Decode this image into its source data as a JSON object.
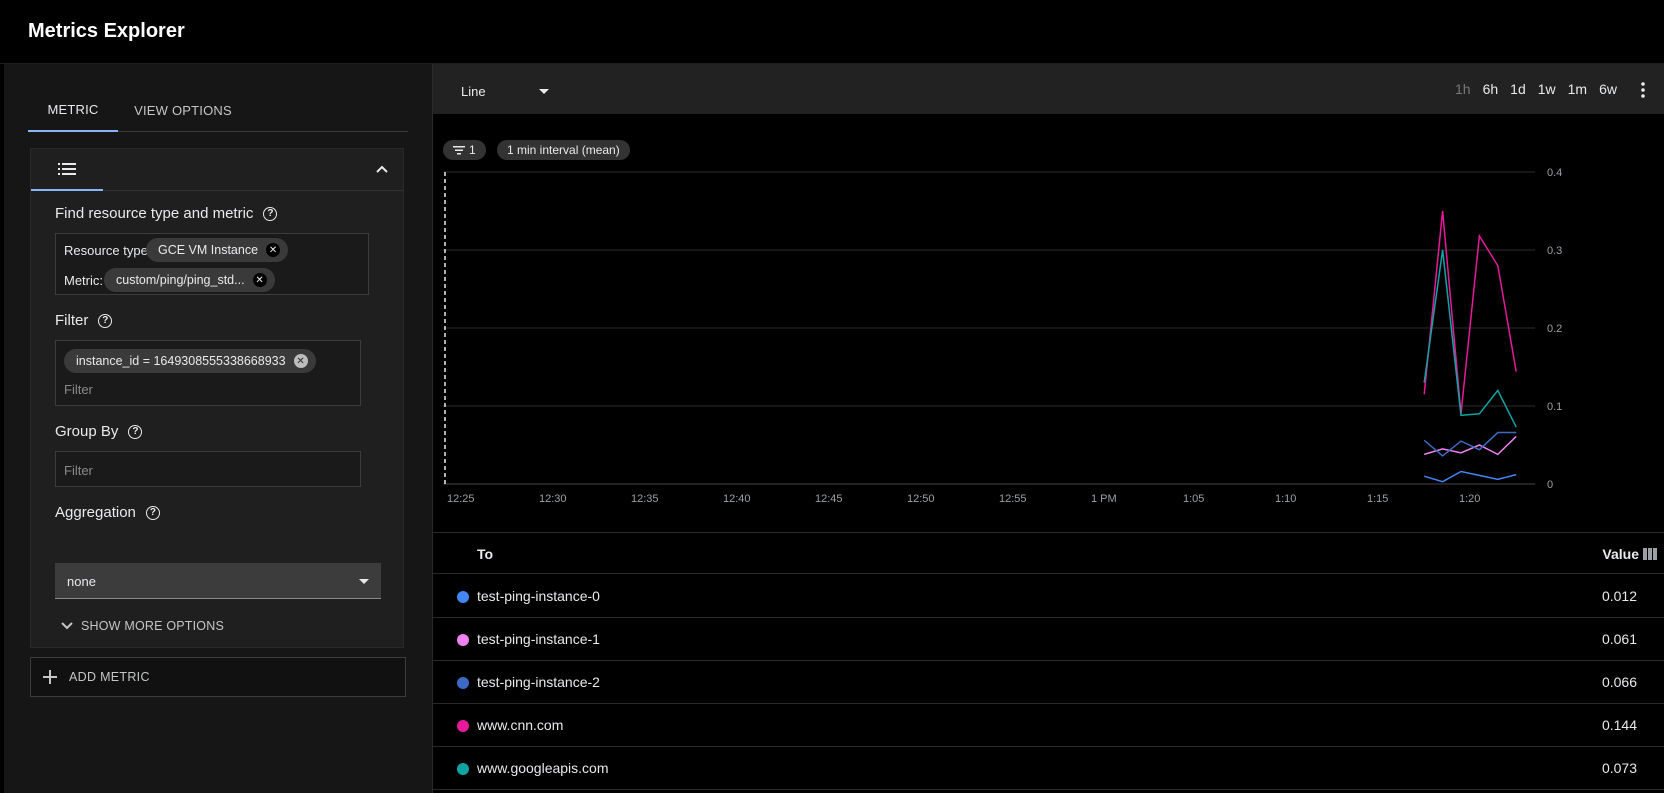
{
  "app": {
    "title": "Metrics Explorer"
  },
  "tabs": [
    {
      "label": "METRIC"
    },
    {
      "label": "VIEW OPTIONS"
    }
  ],
  "find": {
    "label": "Find resource type and metric",
    "resource_label": "Resource type:",
    "resource_value": "GCE VM Instance",
    "metric_label": "Metric:",
    "metric_value": "custom/ping/ping_std..."
  },
  "filter": {
    "label": "Filter",
    "chip": "instance_id = 1649308555338668933",
    "placeholder": "Filter"
  },
  "group_by": {
    "label": "Group By",
    "placeholder": "Filter"
  },
  "aggregation": {
    "label": "Aggregation",
    "value": "none"
  },
  "show_more": "SHOW MORE OPTIONS",
  "add_metric": "ADD METRIC",
  "toolbar": {
    "chart_type": "Line",
    "ranges": [
      "1h",
      "6h",
      "1d",
      "1w",
      "1m",
      "6w"
    ]
  },
  "pills": {
    "filter_count": "1",
    "interval": "1 min interval (mean)"
  },
  "legend": {
    "col_name": "To",
    "col_value": "Value",
    "rows": [
      {
        "name": "test-ping-instance-0",
        "value": "0.012",
        "color": "#4285f4"
      },
      {
        "name": "test-ping-instance-1",
        "value": "0.061",
        "color": "#ee82ee"
      },
      {
        "name": "test-ping-instance-2",
        "value": "0.066",
        "color": "#3f6ac4"
      },
      {
        "name": "www.cnn.com",
        "value": "0.144",
        "color": "#e8199a"
      },
      {
        "name": "www.googleapis.com",
        "value": "0.073",
        "color": "#12a4a4"
      }
    ]
  },
  "chart_data": {
    "type": "line",
    "x_ticks": [
      "12:25",
      "12:30",
      "12:35",
      "12:40",
      "12:45",
      "12:50",
      "12:55",
      "1 PM",
      "1:05",
      "1:10",
      "1:15",
      "1:20"
    ],
    "y_ticks": [
      "0",
      "0.1",
      "0.2",
      "0.3",
      "0.4"
    ],
    "ylim": [
      0,
      0.4
    ],
    "x_minutes_start": 0,
    "x_minutes_per_tick": 5,
    "grid": true,
    "series": [
      {
        "name": "test-ping-instance-0",
        "color": "#4285f4",
        "x": [
          53,
          54,
          55,
          56,
          57,
          58
        ],
        "values": [
          0.01,
          0.003,
          0.016,
          0.011,
          0.006,
          0.012
        ]
      },
      {
        "name": "test-ping-instance-1",
        "color": "#ee82ee",
        "x": [
          53,
          54,
          55,
          56,
          57,
          58
        ],
        "values": [
          0.038,
          0.045,
          0.04,
          0.05,
          0.038,
          0.061
        ]
      },
      {
        "name": "test-ping-instance-2",
        "color": "#3f6ac4",
        "x": [
          53,
          54,
          55,
          56,
          57,
          58
        ],
        "values": [
          0.056,
          0.036,
          0.055,
          0.044,
          0.066,
          0.066
        ]
      },
      {
        "name": "www.cnn.com",
        "color": "#e8199a",
        "x": [
          53,
          54,
          55,
          56,
          57,
          58
        ],
        "values": [
          0.115,
          0.35,
          0.09,
          0.318,
          0.28,
          0.144
        ]
      },
      {
        "name": "www.googleapis.com",
        "color": "#12a4a4",
        "x": [
          53,
          54,
          55,
          56,
          57,
          58
        ],
        "values": [
          0.13,
          0.3,
          0.088,
          0.09,
          0.12,
          0.073
        ]
      }
    ]
  }
}
